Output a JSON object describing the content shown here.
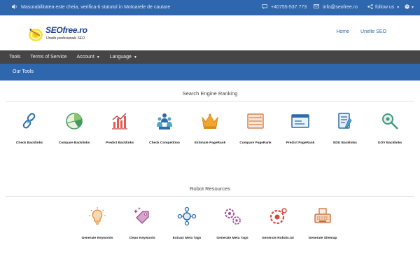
{
  "topbar": {
    "notice": "Masurabilitatea este cheia, verifica-ti statutul in Motoarele de cautare",
    "phone": "+40755-537.773",
    "email": "info@seofree.ro",
    "follow": "follow us"
  },
  "header": {
    "brand": "SEOfree.ro",
    "tagline": "Unelte profesionale SEO",
    "nav": [
      "Home",
      "Unelte SEO"
    ]
  },
  "menubar": {
    "items": [
      "Tools",
      "Terms of Service",
      "Account",
      "Language"
    ]
  },
  "subbar": {
    "label": "Our Tools"
  },
  "sections": [
    {
      "title": "Search Engine Ranking",
      "tools": [
        {
          "label": "Check Backlinks",
          "icon": "chain-link-icon"
        },
        {
          "label": "Compare Backlinks",
          "icon": "pie-chart-icon"
        },
        {
          "label": "Predict Backlinks",
          "icon": "bar-chart-icon"
        },
        {
          "label": "Check Competition",
          "icon": "competitors-icon"
        },
        {
          "label": "Estimate PageRank",
          "icon": "crown-icon"
        },
        {
          "label": "Compare PageRank",
          "icon": "server-rack-icon"
        },
        {
          "label": "Predict PageRank",
          "icon": "browser-window-icon"
        },
        {
          "label": "EDU Backlinks",
          "icon": "book-pen-icon"
        },
        {
          "label": "GOV Backlinks",
          "icon": "magnifier-link-icon"
        }
      ]
    },
    {
      "title": "Robot Resources",
      "tools": [
        {
          "label": "Generate Keywords",
          "icon": "lightbulb-icon"
        },
        {
          "label": "Clean Keywords",
          "icon": "tag-sparkle-icon"
        },
        {
          "label": "Extract Meta Tags",
          "icon": "network-icon"
        },
        {
          "label": "Generate Meta Tags",
          "icon": "gears-icon"
        },
        {
          "label": "Generate Robots.txt",
          "icon": "robot-gear-icon"
        },
        {
          "label": "Generate Sitemap",
          "icon": "typewriter-icon"
        }
      ]
    }
  ],
  "colors": {
    "topbar": "#2e67ad",
    "menubar": "#454545",
    "link": "#2e67ad"
  }
}
